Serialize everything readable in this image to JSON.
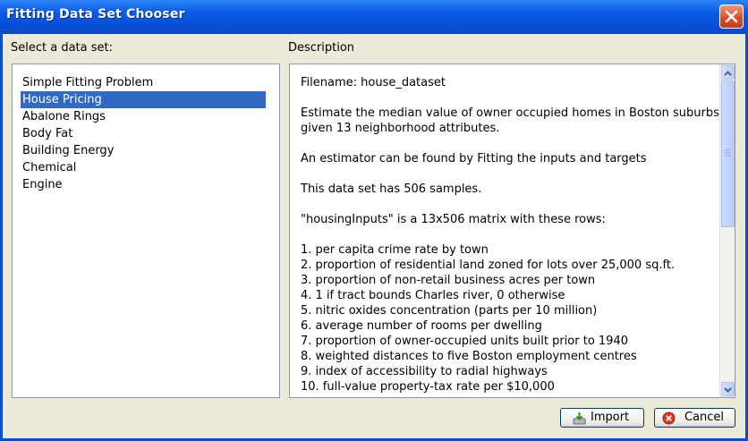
{
  "window": {
    "title": "Fitting Data Set Chooser"
  },
  "left_panel": {
    "label": "Select a data set:",
    "items": [
      "Simple Fitting Problem",
      "House Pricing",
      "Abalone Rings",
      "Body Fat",
      "Building Energy",
      "Chemical",
      "Engine"
    ],
    "selected": "House Pricing"
  },
  "right_panel": {
    "label": "Description",
    "lines": [
      "Filename: house_dataset",
      "",
      "Estimate the median value of owner occupied homes in Boston suburbs",
      "given 13 neighborhood attributes.",
      "",
      "An estimator can be found by Fitting the inputs and targets",
      "",
      "This data set has 506 samples.",
      "",
      "\"housingInputs\" is a 13x506 matrix with these rows:",
      "",
      "1. per capita crime rate by town",
      "2. proportion of residential land zoned for lots over 25,000 sq.ft.",
      "3. proportion of non-retail business acres per town",
      "4. 1 if tract bounds Charles river, 0 otherwise",
      "5. nitric oxides concentration (parts per 10 million)",
      "6. average number of rooms per dwelling",
      "7. proportion of owner-occupied units built prior to 1940",
      "8. weighted distances to five Boston employment centres",
      "9. index of accessibility to radial highways",
      "10. full-value property-tax rate per $10,000"
    ]
  },
  "buttons": {
    "import": "Import",
    "cancel": "Cancel"
  }
}
